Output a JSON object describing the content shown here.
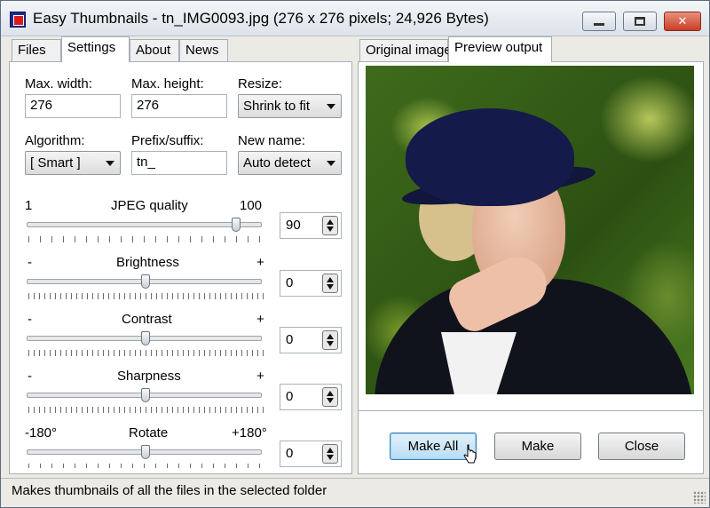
{
  "window": {
    "title": "Easy Thumbnails - tn_IMG0093.jpg  (276 x 276 pixels;  24,926 Bytes)"
  },
  "left_tabs": [
    {
      "label": "Files"
    },
    {
      "label": "Settings"
    },
    {
      "label": "About"
    },
    {
      "label": "News"
    }
  ],
  "right_tabs": [
    {
      "label": "Original image"
    },
    {
      "label": "Preview output"
    }
  ],
  "settings": {
    "max_width_label": "Max. width:",
    "max_width_value": "276",
    "max_height_label": "Max. height:",
    "max_height_value": "276",
    "resize_label": "Resize:",
    "resize_value": "Shrink to fit",
    "algorithm_label": "Algorithm:",
    "algorithm_value": "[ Smart ]",
    "prefix_label": "Prefix/suffix:",
    "prefix_value": "tn_",
    "newname_label": "New name:",
    "newname_value": "Auto detect"
  },
  "sliders": {
    "jpeg": {
      "min_label": "1",
      "label": "JPEG quality",
      "max_label": "100",
      "value": "90"
    },
    "brightness": {
      "min_label": "-",
      "label": "Brightness",
      "max_label": "+",
      "value": "0"
    },
    "contrast": {
      "min_label": "-",
      "label": "Contrast",
      "max_label": "+",
      "value": "0"
    },
    "sharpness": {
      "min_label": "-",
      "label": "Sharpness",
      "max_label": "+",
      "value": "0"
    },
    "rotate": {
      "min_label": "-180°",
      "label": "Rotate",
      "max_label": "+180°",
      "value": "0"
    }
  },
  "buttons": {
    "make_all": "Make All",
    "make": "Make",
    "close": "Close"
  },
  "status": {
    "text": "Makes thumbnails of all the files in the selected folder"
  },
  "colors": {
    "accent": "#3c7fb1",
    "close_button": "#c93d26"
  }
}
